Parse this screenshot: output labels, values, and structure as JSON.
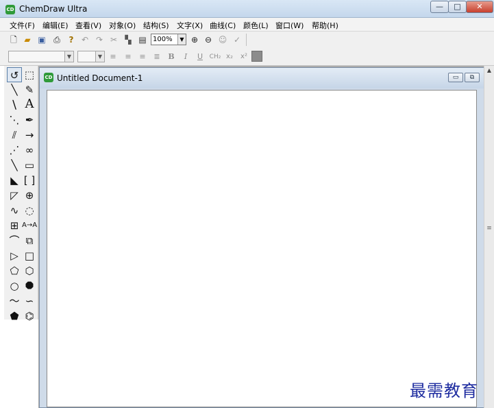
{
  "window": {
    "title": "ChemDraw Ultra",
    "icon_label": "CD",
    "controls": {
      "minimize": "—",
      "maximize": "□",
      "close": "✕"
    }
  },
  "menu": {
    "items": [
      "文件(F)",
      "编辑(E)",
      "查看(V)",
      "对象(O)",
      "结构(S)",
      "文字(X)",
      "曲线(C)",
      "颜色(L)",
      "窗口(W)",
      "帮助(H)"
    ]
  },
  "toolbar": {
    "zoom_value": "100%",
    "icons": [
      "new-document-icon",
      "open-folder-icon",
      "save-icon",
      "print-icon",
      "help-icon",
      "undo-icon",
      "redo-icon",
      "cut-icon",
      "copy-icon",
      "paste-icon",
      "zoom-in-icon",
      "zoom-out-icon",
      "show-icon",
      "check-icon"
    ]
  },
  "format_toolbar": {
    "labels": {
      "bold": "B",
      "italic": "I",
      "underline": "U",
      "ch2": "CH₂",
      "subscript": "x₂",
      "superscript": "x²"
    }
  },
  "palette": {
    "text_tool_label": "A"
  },
  "document": {
    "title": "Untitled Document-1",
    "icon_label": "CD"
  },
  "watermark": "最需教育"
}
